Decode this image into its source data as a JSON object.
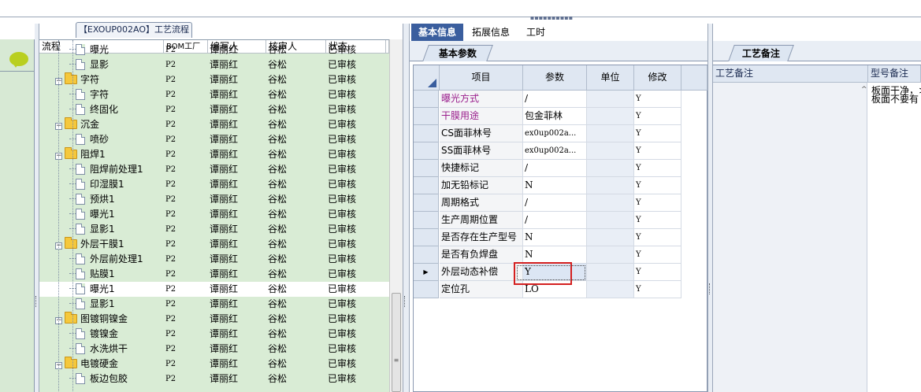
{
  "flow_tab": {
    "label": "【EXOUP002AO】工艺流程"
  },
  "tree": {
    "headers": {
      "name": "流程",
      "bom": "BOM工厂",
      "writer": "编写人",
      "checker": "核审人",
      "status": "状态"
    },
    "rows": [
      {
        "level": 2,
        "type": "doc",
        "name": "曝光",
        "bom": "P2",
        "writer": "谭丽红",
        "checker": "谷松",
        "status": "已审核"
      },
      {
        "level": 2,
        "type": "doc",
        "name": "显影",
        "bom": "P2",
        "writer": "谭丽红",
        "checker": "谷松",
        "status": "已审核"
      },
      {
        "level": 1,
        "type": "folder",
        "name": "字符",
        "bom": "P2",
        "writer": "谭丽红",
        "checker": "谷松",
        "status": "已审核"
      },
      {
        "level": 2,
        "type": "doc",
        "name": "字符",
        "bom": "P2",
        "writer": "谭丽红",
        "checker": "谷松",
        "status": "已审核"
      },
      {
        "level": 2,
        "type": "doc",
        "name": "终固化",
        "bom": "P2",
        "writer": "谭丽红",
        "checker": "谷松",
        "status": "已审核"
      },
      {
        "level": 1,
        "type": "folder",
        "name": "沉金",
        "bom": "P2",
        "writer": "谭丽红",
        "checker": "谷松",
        "status": "已审核"
      },
      {
        "level": 2,
        "type": "doc",
        "name": "喷砂",
        "bom": "P2",
        "writer": "谭丽红",
        "checker": "谷松",
        "status": "已审核"
      },
      {
        "level": 1,
        "type": "folder",
        "name": "阻焊1",
        "bom": "P2",
        "writer": "谭丽红",
        "checker": "谷松",
        "status": "已审核"
      },
      {
        "level": 2,
        "type": "doc",
        "name": "阻焊前处理1",
        "bom": "P2",
        "writer": "谭丽红",
        "checker": "谷松",
        "status": "已审核"
      },
      {
        "level": 2,
        "type": "doc",
        "name": "印湿膜1",
        "bom": "P2",
        "writer": "谭丽红",
        "checker": "谷松",
        "status": "已审核"
      },
      {
        "level": 2,
        "type": "doc",
        "name": "预烘1",
        "bom": "P2",
        "writer": "谭丽红",
        "checker": "谷松",
        "status": "已审核"
      },
      {
        "level": 2,
        "type": "doc",
        "name": "曝光1",
        "bom": "P2",
        "writer": "谭丽红",
        "checker": "谷松",
        "status": "已审核"
      },
      {
        "level": 2,
        "type": "doc",
        "name": "显影1",
        "bom": "P2",
        "writer": "谭丽红",
        "checker": "谷松",
        "status": "已审核"
      },
      {
        "level": 1,
        "type": "folder",
        "name": "外层干膜1",
        "bom": "P2",
        "writer": "谭丽红",
        "checker": "谷松",
        "status": "已审核"
      },
      {
        "level": 2,
        "type": "doc",
        "name": "外层前处理1",
        "bom": "P2",
        "writer": "谭丽红",
        "checker": "谷松",
        "status": "已审核"
      },
      {
        "level": 2,
        "type": "doc",
        "name": "贴膜1",
        "bom": "P2",
        "writer": "谭丽红",
        "checker": "谷松",
        "status": "已审核"
      },
      {
        "level": 2,
        "type": "doc",
        "name": "曝光1",
        "bom": "P2",
        "writer": "谭丽红",
        "checker": "谷松",
        "status": "已审核",
        "selected": true
      },
      {
        "level": 2,
        "type": "doc",
        "name": "显影1",
        "bom": "P2",
        "writer": "谭丽红",
        "checker": "谷松",
        "status": "已审核"
      },
      {
        "level": 1,
        "type": "folder",
        "name": "图镀铜镍金",
        "bom": "P2",
        "writer": "谭丽红",
        "checker": "谷松",
        "status": "已审核"
      },
      {
        "level": 2,
        "type": "doc",
        "name": "镀镍金",
        "bom": "P2",
        "writer": "谭丽红",
        "checker": "谷松",
        "status": "已审核"
      },
      {
        "level": 2,
        "type": "doc",
        "name": "水洗烘干",
        "bom": "P2",
        "writer": "谭丽红",
        "checker": "谷松",
        "status": "已审核"
      },
      {
        "level": 1,
        "type": "folder",
        "name": "电镀硬金",
        "bom": "P2",
        "writer": "谭丽红",
        "checker": "谷松",
        "status": "已审核"
      },
      {
        "level": 2,
        "type": "doc",
        "name": "板边包胶",
        "bom": "P2",
        "writer": "谭丽红",
        "checker": "谷松",
        "status": "已审核"
      }
    ]
  },
  "middle": {
    "tabs": [
      "基本信息",
      "拓展信息",
      "工时"
    ],
    "active_tab": "基本信息",
    "subtab": "基本参数",
    "grid": {
      "headers": {
        "item": "项目",
        "param": "参数",
        "unit": "单位",
        "edit": "修改"
      },
      "rows": [
        {
          "item": "曝光方式",
          "param": "/",
          "unit": "",
          "edit": "Y",
          "highlight": true
        },
        {
          "item": "干膜用途",
          "param": "包金菲林",
          "unit": "",
          "edit": "Y",
          "highlight": true
        },
        {
          "item": "CS面菲林号",
          "param": "ex0up002a...",
          "unit": "",
          "edit": "Y"
        },
        {
          "item": "SS面菲林号",
          "param": "ex0up002a...",
          "unit": "",
          "edit": "Y"
        },
        {
          "item": "快捷标记",
          "param": "/",
          "unit": "",
          "edit": "Y"
        },
        {
          "item": "加无铅标记",
          "param": "N",
          "unit": "",
          "edit": "Y"
        },
        {
          "item": "周期格式",
          "param": "/",
          "unit": "",
          "edit": "Y"
        },
        {
          "item": "生产周期位置",
          "param": "/",
          "unit": "",
          "edit": "Y"
        },
        {
          "item": "是否存在生产型号",
          "param": "N",
          "unit": "",
          "edit": "Y"
        },
        {
          "item": "是否有负焊盘",
          "param": "N",
          "unit": "",
          "edit": "Y"
        },
        {
          "item": "外层动态补偿",
          "param": "Y",
          "unit": "",
          "edit": "Y",
          "current": true
        },
        {
          "item": "定位孔",
          "param": "LO",
          "unit": "",
          "edit": "Y"
        }
      ]
    },
    "colors": {
      "highlight_text": "#9a1e8c",
      "active_tab_bg": "#3a5e9e",
      "selection_box": "#d42020"
    }
  },
  "right": {
    "tab": "工艺备注",
    "headers": {
      "remark": "工艺备注",
      "model_remark": "型号备注"
    },
    "model_remark_lines": [
      "板面干净，>",
      "板面不要有"
    ]
  }
}
